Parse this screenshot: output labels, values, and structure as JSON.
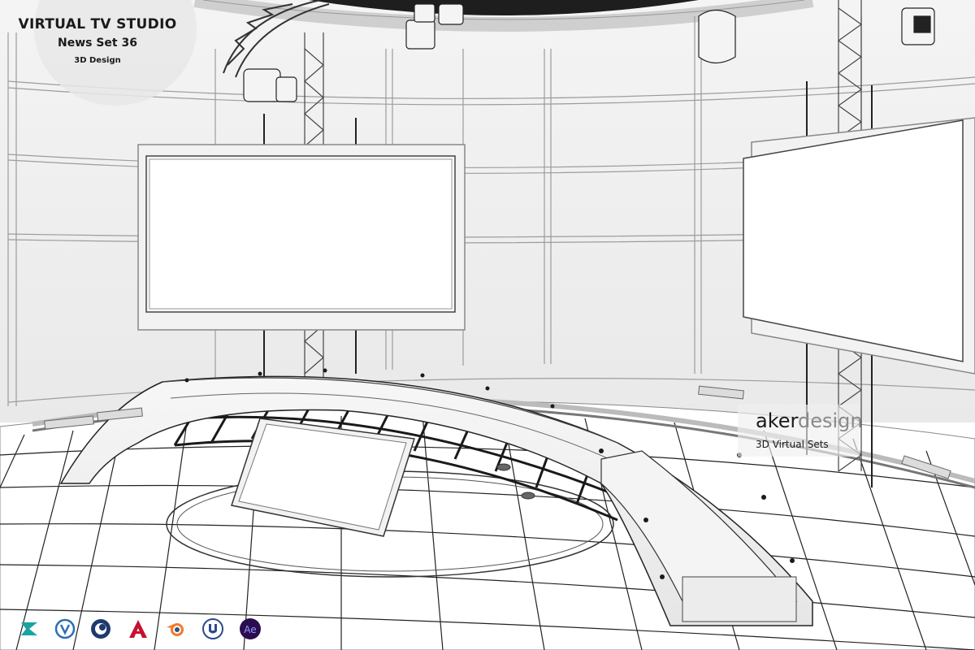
{
  "badge": {
    "title": "VIRTUAL TV STUDIO",
    "subtitle": "News Set 36",
    "caption": "3D Design"
  },
  "brand": {
    "name_dark": "aker",
    "name_light": "design",
    "tagline": "3D Virtual Sets"
  },
  "software_icons": [
    {
      "name": "3ds-max-icon",
      "color": "#1aa3a3"
    },
    {
      "name": "vray-icon",
      "color": "#2a6fb5"
    },
    {
      "name": "cinema4d-icon",
      "color": "#1e3a6e"
    },
    {
      "name": "autocad-icon",
      "color": "#c8102e"
    },
    {
      "name": "blender-icon",
      "color": "#f5792a"
    },
    {
      "name": "unreal-icon",
      "color": "#2a4b8d"
    },
    {
      "name": "after-effects-icon",
      "color": "#9999ff"
    }
  ]
}
